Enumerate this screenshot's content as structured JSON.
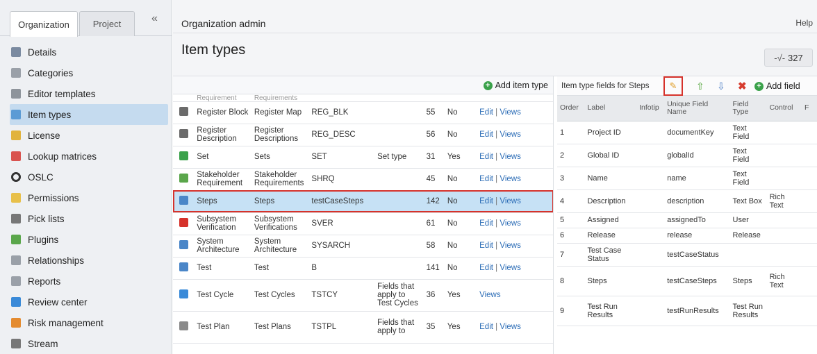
{
  "sidebar": {
    "tabs": [
      "Organization",
      "Project"
    ],
    "collapse": "«",
    "items": [
      {
        "label": "Details",
        "icon": "building-icon",
        "color": "#7a8aa0"
      },
      {
        "label": "Categories",
        "icon": "tag-icon",
        "color": "#9aa0a8"
      },
      {
        "label": "Editor templates",
        "icon": "template-icon",
        "color": "#8e949b"
      },
      {
        "label": "Item types",
        "icon": "item-types-icon",
        "color": "#5b9bd5"
      },
      {
        "label": "License",
        "icon": "key-icon",
        "color": "#e1b33d"
      },
      {
        "label": "Lookup matrices",
        "icon": "matrix-icon",
        "color": "#d9534f"
      },
      {
        "label": "OSLC",
        "icon": "oslc-icon",
        "color": "#333333"
      },
      {
        "label": "Permissions",
        "icon": "shield-icon",
        "color": "#e8c04a"
      },
      {
        "label": "Pick lists",
        "icon": "list-icon",
        "color": "#777777"
      },
      {
        "label": "Plugins",
        "icon": "puzzle-icon",
        "color": "#5aa64b"
      },
      {
        "label": "Relationships",
        "icon": "relationship-icon",
        "color": "#9aa0a8"
      },
      {
        "label": "Reports",
        "icon": "chart-icon",
        "color": "#9aa0a8"
      },
      {
        "label": "Review center",
        "icon": "review-icon",
        "color": "#3a8ad8"
      },
      {
        "label": "Risk management",
        "icon": "risk-icon",
        "color": "#e48b2f"
      },
      {
        "label": "Stream",
        "icon": "stream-icon",
        "color": "#777777"
      }
    ]
  },
  "header": {
    "org_title": "Organization admin",
    "help": "Help",
    "page_title": "Item types",
    "count": "327"
  },
  "types": {
    "add_label": "Add item type",
    "partial_row": [
      "Requirement",
      "Requirements"
    ],
    "rows": [
      {
        "icon_color": "#6b6b6b",
        "name": "Register Block",
        "plural": "Register Map",
        "prefix": "REG_BLK",
        "special": "",
        "id": "55",
        "sys": "No",
        "edit": "Edit",
        "views": "Views",
        "tall": false,
        "selected": false
      },
      {
        "icon_color": "#6b6b6b",
        "name": "Register Description",
        "plural": "Register Descriptions",
        "prefix": "REG_DESC",
        "special": "",
        "id": "56",
        "sys": "No",
        "edit": "Edit",
        "views": "Views",
        "tall": false,
        "selected": false
      },
      {
        "icon_color": "#3aa14a",
        "name": "Set",
        "plural": "Sets",
        "prefix": "SET",
        "special": "Set type",
        "id": "31",
        "sys": "Yes",
        "edit": "Edit",
        "views": "Views",
        "tall": false,
        "selected": false
      },
      {
        "icon_color": "#5aa64b",
        "name": "Stakeholder Requirement",
        "plural": "Stakeholder Requirements",
        "prefix": "SHRQ",
        "special": "",
        "id": "45",
        "sys": "No",
        "edit": "Edit",
        "views": "Views",
        "tall": false,
        "selected": false
      },
      {
        "icon_color": "#4a86c8",
        "name": "Steps",
        "plural": "Steps",
        "prefix": "testCaseSteps",
        "special": "",
        "id": "142",
        "sys": "No",
        "edit": "Edit",
        "views": "Views",
        "tall": false,
        "selected": true
      },
      {
        "icon_color": "#d6322b",
        "name": "Subsystem Verification",
        "plural": "Subsystem Verifications",
        "prefix": "SVER",
        "special": "",
        "id": "61",
        "sys": "No",
        "edit": "Edit",
        "views": "Views",
        "tall": false,
        "selected": false
      },
      {
        "icon_color": "#4a86c8",
        "name": "System Architecture",
        "plural": "System Architecture",
        "prefix": "SYSARCH",
        "special": "",
        "id": "58",
        "sys": "No",
        "edit": "Edit",
        "views": "Views",
        "tall": false,
        "selected": false
      },
      {
        "icon_color": "#4a86c8",
        "name": "Test",
        "plural": "Test",
        "prefix": "B",
        "special": "",
        "id": "141",
        "sys": "No",
        "edit": "Edit",
        "views": "Views",
        "tall": false,
        "selected": false
      },
      {
        "icon_color": "#3a8ad8",
        "name": "Test Cycle",
        "plural": "Test Cycles",
        "prefix": "TSTCY",
        "special": "Fields that apply to Test Cycles",
        "id": "36",
        "sys": "Yes",
        "edit": "",
        "views": "Views",
        "tall": true,
        "selected": false
      },
      {
        "icon_color": "#8a8a8a",
        "name": "Test Plan",
        "plural": "Test Plans",
        "prefix": "TSTPL",
        "special": "Fields that apply to",
        "id": "35",
        "sys": "Yes",
        "edit": "Edit",
        "views": "Views",
        "tall": true,
        "selected": false
      }
    ]
  },
  "fields": {
    "title": "Item type fields for Steps",
    "add_label": "Add field",
    "headers": [
      "Order",
      "Label",
      "Infotip",
      "Unique Field Name",
      "Field Type",
      "Control",
      "F"
    ],
    "rows": [
      {
        "order": "1",
        "label": "Project ID",
        "uid": "documentKey",
        "type": "Text Field",
        "control": ""
      },
      {
        "order": "2",
        "label": "Global ID",
        "uid": "globalId",
        "type": "Text Field",
        "control": ""
      },
      {
        "order": "3",
        "label": "Name",
        "uid": "name",
        "type": "Text Field",
        "control": ""
      },
      {
        "order": "4",
        "label": "Description",
        "uid": "description",
        "type": "Text Box",
        "control": "Rich Text"
      },
      {
        "order": "5",
        "label": "Assigned",
        "uid": "assignedTo",
        "type": "User",
        "control": ""
      },
      {
        "order": "6",
        "label": "Release",
        "uid": "release",
        "type": "Release",
        "control": ""
      },
      {
        "order": "7",
        "label": "Test Case Status",
        "uid": "testCaseStatus",
        "type": "",
        "control": ""
      },
      {
        "order": "8",
        "label": "Steps",
        "uid": "testCaseSteps",
        "type": "Steps",
        "control": "Rich Text"
      },
      {
        "order": "9",
        "label": "Test Run Results",
        "uid": "testRunResults",
        "type": "Test Run Results",
        "control": ""
      }
    ]
  }
}
